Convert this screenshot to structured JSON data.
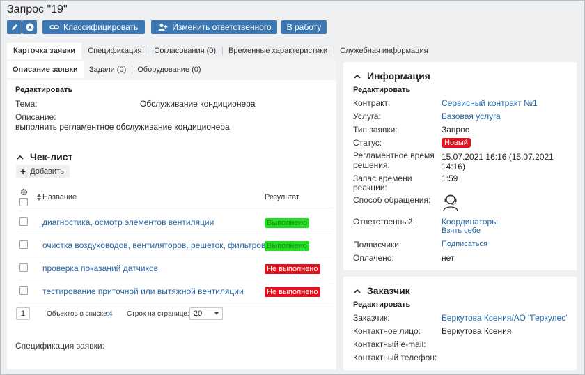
{
  "page": {
    "title": "Запрос \"19\""
  },
  "toolbar": {
    "classify_label": "Классифицировать",
    "change_responsible_label": "Изменить ответственного",
    "to_work_label": "В работу"
  },
  "main_tabs": [
    {
      "label": "Карточка заявки",
      "active": true
    },
    {
      "label": "Спецификация"
    },
    {
      "label": "Согласования (0)"
    },
    {
      "label": "Временные характеристики"
    },
    {
      "label": "Служебная информация"
    }
  ],
  "sub_tabs": [
    {
      "label": "Описание заявки",
      "active": true
    },
    {
      "label": "Задачи (0)"
    },
    {
      "label": "Оборудование (0)"
    }
  ],
  "description": {
    "edit_label": "Редактировать",
    "topic_label": "Тема:",
    "topic_value": "Обслуживание кондиционера",
    "desc_label": "Описание:",
    "desc_value": "выполнить регламентное обслуживание кондиционера"
  },
  "checklist": {
    "title": "Чек-лист",
    "add_label": "Добавить",
    "col_name": "Название",
    "col_result": "Результат",
    "rows": [
      {
        "name": "диагностика, осмотр элементов вентиляции",
        "result": "Выполнено",
        "status": "green"
      },
      {
        "name": "очистка воздуховодов, вентиляторов, решеток, фильтров",
        "result": "Выполнено",
        "status": "green"
      },
      {
        "name": "проверка показаний датчиков",
        "result": "Не выполнено",
        "status": "red"
      },
      {
        "name": "тестирование приточной или вытяжной вентиляции",
        "result": "Не выполнено",
        "status": "red"
      }
    ],
    "pager": {
      "page": "1",
      "count_label": "Объектов в списке:",
      "count_value": "4",
      "rows_label": "Строк на странице:",
      "rows_value": "20"
    },
    "spec_label": "Спецификация заявки:"
  },
  "info": {
    "title": "Информация",
    "edit_label": "Редактировать",
    "contract_label": "Контракт:",
    "contract_value": "Сервисный контракт №1",
    "service_label": "Услуга:",
    "service_value": "Базовая услуга",
    "type_label": "Тип заявки:",
    "type_value": "Запрос",
    "status_label": "Статус:",
    "status_value": "Новый",
    "deadline_label_1": "Регламентное время",
    "deadline_label_2": "решения:",
    "deadline_value": "15.07.2021 16:16 (15.07.2021 14:16)",
    "reserve_label_1": "Запас времени",
    "reserve_label_2": "реакции:",
    "reserve_value": "1:59",
    "channel_label": "Способ обращения:",
    "responsible_label": "Ответственный:",
    "responsible_value": "Координаторы",
    "take_label": "Взять себе",
    "subscribers_label": "Подписчики:",
    "subscribe_label": "Подписаться",
    "paid_label": "Оплачено:",
    "paid_value": "нет"
  },
  "customer": {
    "title": "Заказчик",
    "edit_label": "Редактировать",
    "customer_label": "Заказчик:",
    "customer_value": "Беркутова Ксения/АО \"Геркулес\"",
    "contact_label": "Контактное лицо:",
    "contact_value": "Беркутова Ксения",
    "email_label": "Контактный e-mail:",
    "phone_label": "Контактный телефон:"
  },
  "colors": {
    "primary": "#3c78b4",
    "link": "#2566a8",
    "danger": "#e0141e",
    "success": "#22dd22"
  }
}
